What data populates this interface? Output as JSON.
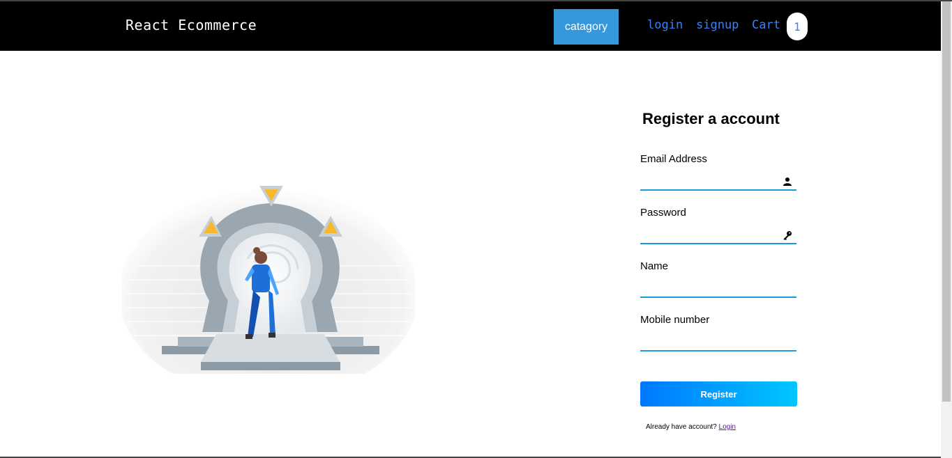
{
  "navbar": {
    "brand": "React Ecommerce",
    "category_button": "catagory",
    "links": {
      "login": "login",
      "signup": "signup",
      "cart": "Cart"
    },
    "cart_count": "1"
  },
  "form": {
    "title": "Register a account",
    "email_label": "Email Address",
    "password_label": "Password",
    "name_label": "Name",
    "mobile_label": "Mobile number",
    "register_button": "Register",
    "already_text": "Already have account?",
    "login_link": "Login"
  },
  "icons": {
    "email": "user-icon",
    "password": "key-icon"
  },
  "colors": {
    "navbar": "#000000",
    "category_button": "#3498db",
    "link": "#3b82f6",
    "field_underline": "#1a9ad6",
    "register_gradient_start": "#0078ff",
    "register_gradient_end": "#00c6ff"
  }
}
